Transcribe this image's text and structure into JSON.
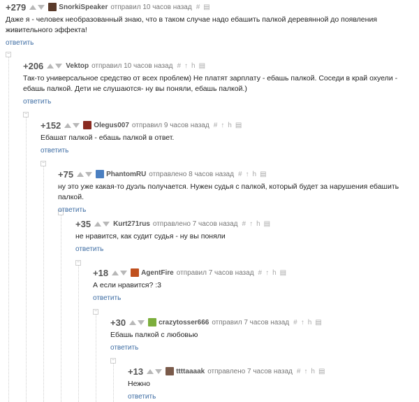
{
  "comments": [
    {
      "score": "+279",
      "author": "SnorkiSpeaker",
      "time": "отправил 10 часов назад",
      "text": "Даже я - человек необразованный знаю, что в таком случае надо ебашить палкой деревянной до появления живительного эффекта!",
      "reply": "ответить",
      "avatar_color": "#5a3a2a"
    },
    {
      "score": "+206",
      "author": "Vektop",
      "time": "отправил 10 часов назад",
      "text": "Так-то универсальное средство от всех проблем) Не платят зарплату - ебашь палкой. Соседи в край охуели - ебашь палкой. Дети не слушаются- ну вы поняли, ебашь палкой.)",
      "reply": "ответить",
      "avatar_color": ""
    },
    {
      "score": "+152",
      "author": "Olegus007",
      "time": "отправил 9 часов назад",
      "text": "Ебашат палкой - ебашь палкой в ответ.",
      "reply": "ответить",
      "avatar_color": "#8a2a20"
    },
    {
      "score": "+75",
      "author": "PhantomRU",
      "time": "отправлено 8 часов назад",
      "text": "ну это уже какая-то дуэль получается. Нужен судья с палкой, который будет за нарушения ебашить палкой.",
      "reply": "ответить",
      "avatar_color": "#4a7fc1"
    },
    {
      "score": "+35",
      "author": "Kurt271rus",
      "time": "отправлено 7 часов назад",
      "text": "не нравится, как судит судья - ну вы поняли",
      "reply": "ответить",
      "avatar_color": ""
    },
    {
      "score": "+18",
      "author": "AgentFire",
      "time": "отправил 7 часов назад",
      "text": "А если нравится? :3",
      "reply": "ответить",
      "avatar_color": "#c0501e"
    },
    {
      "score": "+30",
      "author": "crazytosser666",
      "time": "отправил 7 часов назад",
      "text": "Ебашь палкой с любовью",
      "reply": "ответить",
      "avatar_color": "#7cae3c"
    },
    {
      "score": "+13",
      "author": "ttttaaaak",
      "time": "отправлено 7 часов назад",
      "text": "Нежно",
      "reply": "ответить",
      "avatar_color": "#7a5a4a"
    }
  ],
  "icons": {
    "link": "#",
    "parent": "↑",
    "branch": "h",
    "save": "save-icon"
  },
  "collapse_symbol": "−"
}
